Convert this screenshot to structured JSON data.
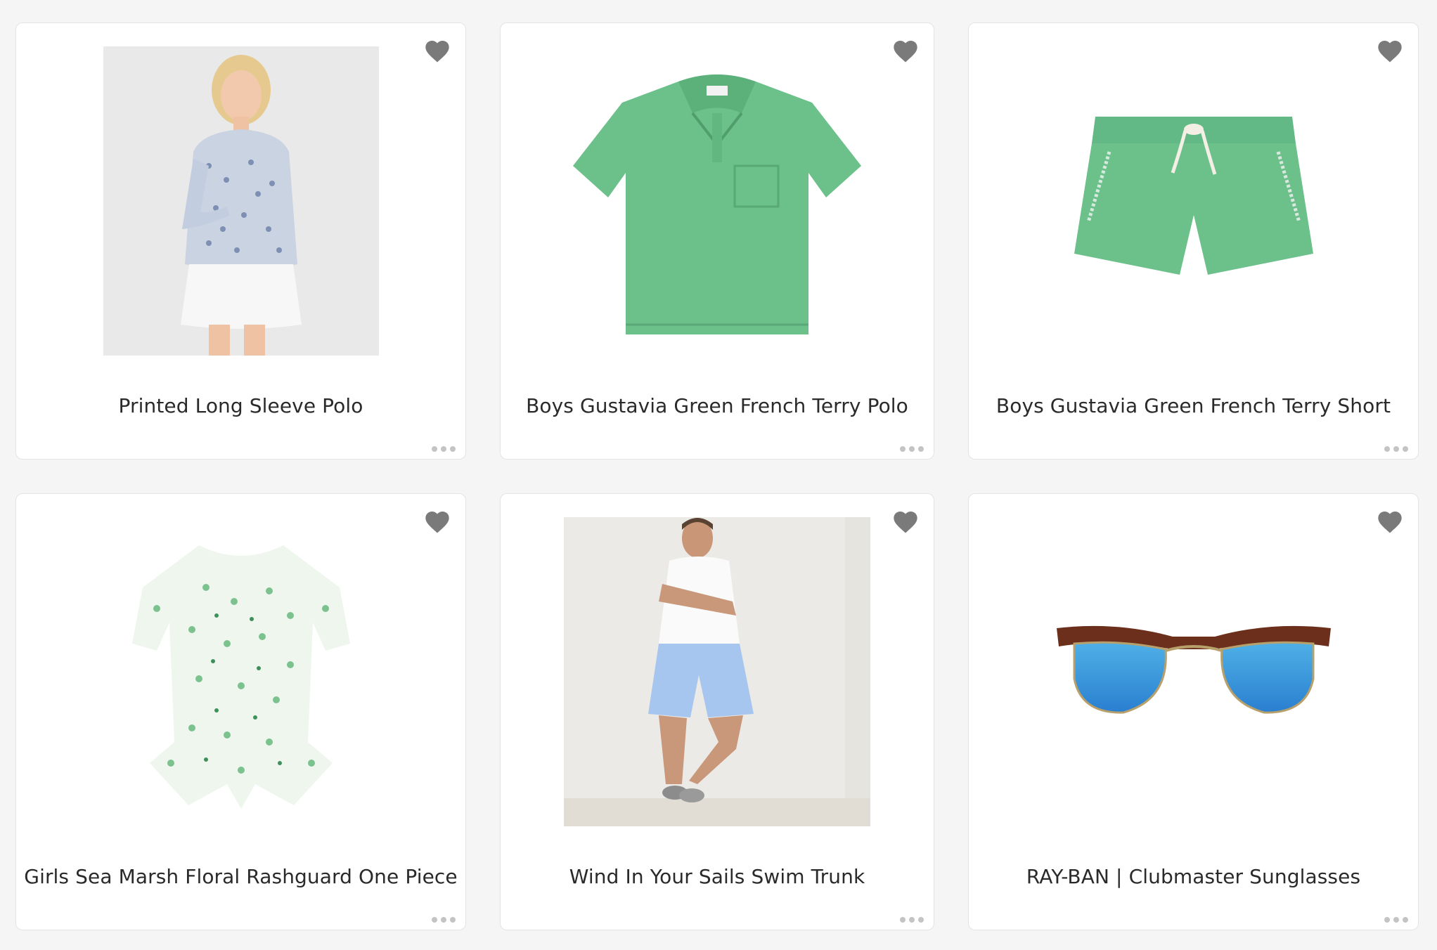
{
  "colors": {
    "page_background": "#f5f5f5",
    "card_background": "#ffffff",
    "heart_icon": "#7a7a7a",
    "more_dots": "#c4c4c4",
    "title_text": "#2a2a2a"
  },
  "products": [
    {
      "title": "Printed Long Sleeve Polo",
      "image_icon": "woman-floral-polo-photo",
      "favorite_icon": "heart-icon",
      "more_icon": "more-options-icon"
    },
    {
      "title": "Boys Gustavia Green French Terry Polo",
      "image_icon": "green-polo-shirt-photo",
      "favorite_icon": "heart-icon",
      "more_icon": "more-options-icon"
    },
    {
      "title": "Boys Gustavia Green French Terry Short",
      "image_icon": "green-shorts-photo",
      "favorite_icon": "heart-icon",
      "more_icon": "more-options-icon"
    },
    {
      "title": "Girls Sea Marsh Floral Rashguard One Piece",
      "image_icon": "floral-rashguard-photo",
      "favorite_icon": "heart-icon",
      "more_icon": "more-options-icon"
    },
    {
      "title": "Wind In Your Sails Swim Trunk",
      "image_icon": "man-swim-trunk-photo",
      "favorite_icon": "heart-icon",
      "more_icon": "more-options-icon"
    },
    {
      "title": "RAY-BAN | Clubmaster Sunglasses",
      "image_icon": "clubmaster-sunglasses-photo",
      "favorite_icon": "heart-icon",
      "more_icon": "more-options-icon"
    }
  ]
}
